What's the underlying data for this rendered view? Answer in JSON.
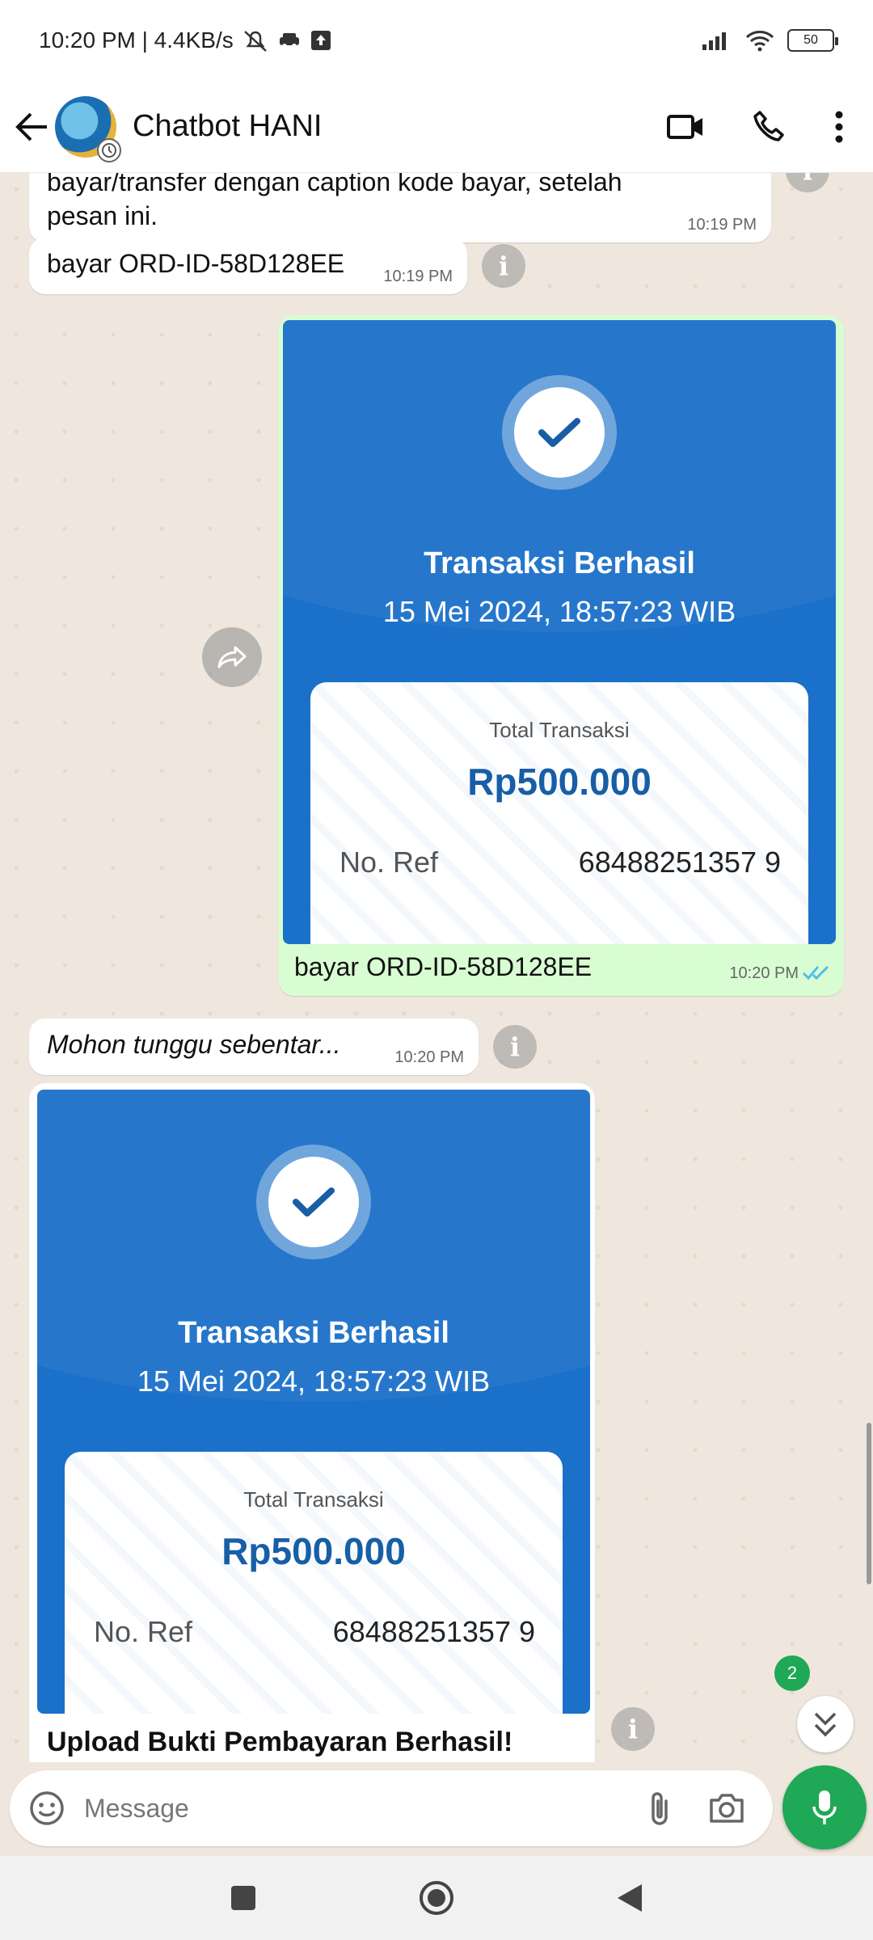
{
  "status_bar": {
    "time": "10:20 PM | 4.4KB/s",
    "battery": "50"
  },
  "header": {
    "title": "Chatbot HANI"
  },
  "messages": {
    "m1": {
      "text_line1": "bayar/transfer dengan caption kode bayar, setelah",
      "text_line2": "pesan ini.",
      "time": "10:19 PM"
    },
    "m2": {
      "text": "bayar ORD-ID-58D128EE",
      "time": "10:19 PM"
    },
    "m3": {
      "receipt": {
        "title": "Transaksi Berhasil",
        "date": "15 Mei 2024, 18:57:23 WIB",
        "total_label": "Total Transaksi",
        "amount": "Rp500.000",
        "ref_label": "No. Ref",
        "ref_value": "68488251357 9"
      },
      "caption": "bayar ORD-ID-58D128EE",
      "time": "10:20 PM"
    },
    "m4": {
      "text": "Mohon tunggu sebentar...",
      "time": "10:20 PM"
    },
    "m5": {
      "receipt": {
        "title": "Transaksi Berhasil",
        "date": "15 Mei 2024, 18:57:23 WIB",
        "total_label": "Total Transaksi",
        "amount": "Rp500.000",
        "ref_label": "No. Ref",
        "ref_value": "68488251357 9"
      },
      "caption": "Upload Bukti Pembayaran Berhasil!"
    }
  },
  "unread_badge": "2",
  "composer": {
    "placeholder": "Message"
  },
  "colors": {
    "accent_green": "#1fa855",
    "outgoing_bubble": "#d9fdd3",
    "receipt_blue": "#1b70c9",
    "read_ticks": "#53bdeb"
  }
}
